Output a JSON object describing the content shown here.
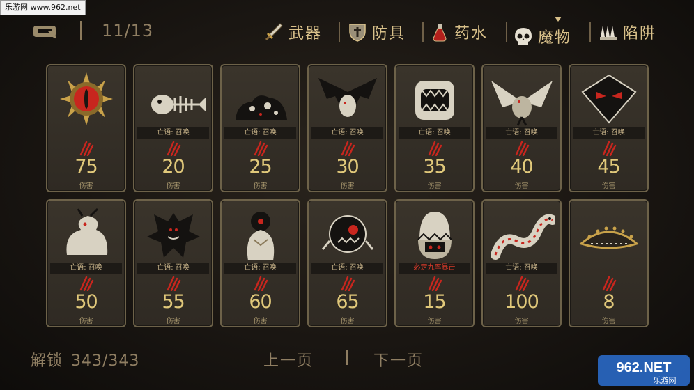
{
  "watermark_top": "乐游网 www.962.net",
  "header": {
    "page_counter": "11/13",
    "tabs": [
      {
        "label": "武器",
        "icon": "sword-icon"
      },
      {
        "label": "防具",
        "icon": "shield-icon"
      },
      {
        "label": "药水",
        "icon": "potion-icon"
      },
      {
        "label": "魔物",
        "icon": "skull-icon",
        "active": true
      },
      {
        "label": "陷阱",
        "icon": "spike-trap-icon"
      }
    ]
  },
  "cards": [
    {
      "ability": "",
      "damage": "75",
      "damage_label": "伤害",
      "art": "sun-eye"
    },
    {
      "ability": "亡语: 召唤",
      "damage": "20",
      "damage_label": "伤害",
      "art": "bone-fish"
    },
    {
      "ability": "亡语: 召唤",
      "damage": "25",
      "damage_label": "伤害",
      "art": "slime"
    },
    {
      "ability": "亡语: 召唤",
      "damage": "30",
      "damage_label": "伤害",
      "art": "bat-dragon"
    },
    {
      "ability": "亡语: 召唤",
      "damage": "35",
      "damage_label": "伤害",
      "art": "rock-mouth"
    },
    {
      "ability": "亡语: 召唤",
      "damage": "40",
      "damage_label": "伤害",
      "art": "bird"
    },
    {
      "ability": "亡语: 召唤",
      "damage": "45",
      "damage_label": "伤害",
      "art": "kite"
    },
    {
      "ability": "亡语: 召唤",
      "damage": "50",
      "damage_label": "伤害",
      "art": "dragon"
    },
    {
      "ability": "亡语: 召唤",
      "damage": "55",
      "damage_label": "伤害",
      "art": "demon"
    },
    {
      "ability": "亡语: 召唤",
      "damage": "60",
      "damage_label": "伤害",
      "art": "owl"
    },
    {
      "ability": "亡语: 召唤",
      "damage": "65",
      "damage_label": "伤害",
      "art": "ball"
    },
    {
      "ability": "必定九率暴击",
      "damage": "15",
      "damage_label": "伤害",
      "art": "egg",
      "ability_red": true
    },
    {
      "ability": "亡语: 召唤",
      "damage": "100",
      "damage_label": "伤害",
      "art": "serpent"
    },
    {
      "ability": "",
      "damage": "8",
      "damage_label": "伤害",
      "art": "slug"
    }
  ],
  "footer": {
    "unlock_label": "解锁",
    "unlock_count": "343/343",
    "prev_page": "上一页",
    "next_page": "下一页"
  },
  "brand": {
    "logo_text": "962.NET",
    "sub_text": "乐游网"
  },
  "colors": {
    "gold": "#d8c08a",
    "damage": "#e0c87a",
    "claw_red": "#c8261e",
    "card_border": "#6d6249"
  }
}
